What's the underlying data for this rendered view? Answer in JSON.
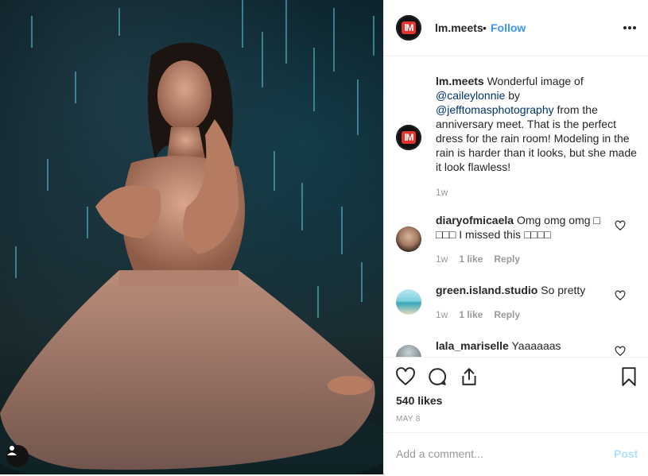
{
  "post": {
    "account": "lm.meets",
    "separator": "•",
    "follow_label": "Follow",
    "caption_user": "lm.meets",
    "caption_parts": [
      " Wonderful image of ",
      "@caileylonnie",
      " by ",
      "@jefftomasphotography",
      " from the anniversary meet. That is the perfect dress for the rain room! Modeling in the rain is harder than it looks, but she made it look flawless!"
    ],
    "caption_time": "1w",
    "logo_text": "lM"
  },
  "comments": [
    {
      "user": "diaryofmicaela",
      "text": " Omg omg omg □ □□□ I missed this □□□□",
      "time": "1w",
      "likes": "1 like",
      "reply": "Reply"
    },
    {
      "user": "green.island.studio",
      "text": " So pretty",
      "time": "1w",
      "likes": "1 like",
      "reply": "Reply"
    },
    {
      "user": "lala_mariselle",
      "text": " Yaaaaaas"
    }
  ],
  "footer": {
    "likes": "540 likes",
    "date": "MAY 8",
    "comment_placeholder": "Add a comment...",
    "post_label": "Post"
  },
  "colors": {
    "link": "#3897f0",
    "mention": "#003569",
    "muted": "#999999",
    "post_disabled": "#b2dffc"
  }
}
